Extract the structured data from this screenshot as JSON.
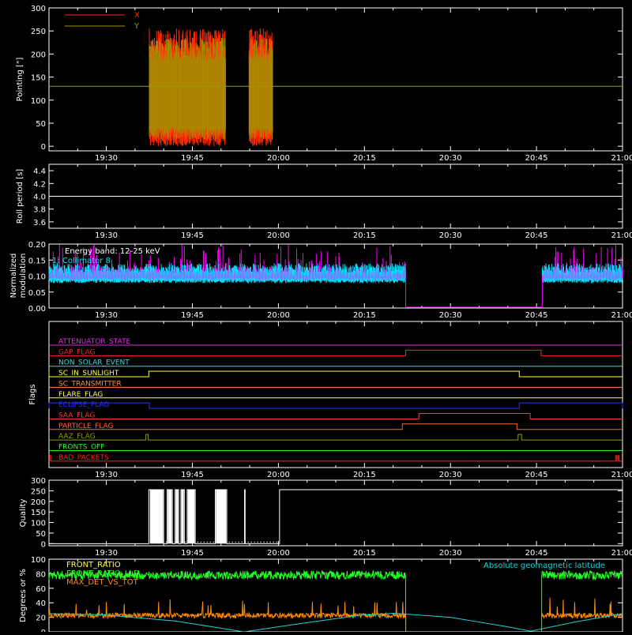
{
  "colors": {
    "background": "#000000",
    "axes": "#ffffff",
    "x_pointing": "#ff2a00",
    "y_pointing": "#9a9a00",
    "collimator": "#00e5ff",
    "modulation": "#ff00ff",
    "front_ratio": "#22ff22",
    "max_det": "#ff8c00",
    "geo_lat": "#22d0d0"
  },
  "time_axis": {
    "ticks": [
      "19:30",
      "19:45",
      "20:00",
      "20:15",
      "20:30",
      "20:45",
      "21:00"
    ],
    "tick_minutes": [
      1170,
      1185,
      1200,
      1215,
      1230,
      1245,
      1260
    ],
    "range_minutes": [
      1160,
      1260
    ]
  },
  "chart_data": [
    {
      "id": "pointing",
      "type": "line",
      "ylabel": "Pointing [\"]",
      "ylim": [
        -10,
        300
      ],
      "yticks": [
        0,
        50,
        100,
        150,
        200,
        250,
        300
      ],
      "legend": [
        "X",
        "Y"
      ],
      "segments": [
        [
          1177.5,
          1190.8
        ],
        [
          1194.9,
          1199.0
        ]
      ],
      "constant_line": 130,
      "series": [
        {
          "name": "X",
          "low": 0,
          "high": 255
        },
        {
          "name": "Y",
          "low": 15,
          "high": 235
        }
      ]
    },
    {
      "id": "roll",
      "type": "line",
      "ylabel": "Roll period [s]",
      "ylim": [
        3.5,
        4.5
      ],
      "yticks": [
        3.6,
        3.8,
        4.0,
        4.2,
        4.4
      ],
      "value": 4.0
    },
    {
      "id": "modulation",
      "type": "line",
      "ylabel": "Normalized modulation",
      "ylim": [
        0,
        0.2
      ],
      "yticks": [
        "0.00",
        "0.05",
        "0.10",
        "0.15",
        "0.20"
      ],
      "annotation_lines": [
        "Energy band: 12-25 keV",
        "1: Collimator 8"
      ],
      "active_segments": [
        [
          1160,
          1222.2
        ],
        [
          1246.0,
          1260
        ]
      ],
      "zero_segment": [
        1222.2,
        1246.0
      ],
      "baseline": 0.1
    },
    {
      "id": "flags",
      "type": "step",
      "ylabel": "Flags",
      "flags": [
        {
          "label": "ATTENUATOR_STATE",
          "color": "#e030e0",
          "steps": []
        },
        {
          "label": "GAP_FLAG",
          "color": "#ff2222",
          "steps": [
            [
              1222.2,
              1245.8
            ]
          ]
        },
        {
          "label": "NON_SOLAR_EVENT",
          "color": "#33dddd",
          "steps": []
        },
        {
          "label": "SC_IN_SUNLIGHT",
          "color": "#ffff44",
          "steps": [
            [
              1160,
              1160
            ],
            [
              1177.4,
              1242.0
            ]
          ]
        },
        {
          "label": "SC_TRANSMITTER",
          "color": "#ff8844",
          "steps": []
        },
        {
          "label": "FLARE_FLAG",
          "color": "#ffff44",
          "steps": []
        },
        {
          "label": "ECLIPSE_FLAG",
          "color": "#2233ff",
          "steps": [
            [
              1160,
              1177.5
            ],
            [
              1242.0,
              1260
            ]
          ]
        },
        {
          "label": "SAA_FLAG",
          "color": "#ff3333",
          "steps": [
            [
              1224.5,
              1243.9
            ]
          ]
        },
        {
          "label": "PARTICLE_FLAG",
          "color": "#ff6633",
          "steps": [
            [
              1221.6,
              1241.6
            ]
          ]
        },
        {
          "label": "AAZ_FLAG",
          "color": "#9a9a00",
          "steps": [
            [
              1176.9,
              1177.3
            ],
            [
              1241.8,
              1242.4
            ]
          ]
        },
        {
          "label": "FRONTS_OFF",
          "color": "#22ff22",
          "steps": []
        },
        {
          "label": "BAD_PACKETS",
          "color": "#ff2222",
          "steps": [
            [
              1160.1,
              1160.3
            ],
            [
              1258.8,
              1259.0
            ],
            [
              1259.2,
              1259.4
            ]
          ]
        }
      ]
    },
    {
      "id": "quality",
      "type": "step",
      "ylabel": "Quality",
      "ylim": [
        -10,
        300
      ],
      "yticks": [
        0,
        50,
        100,
        150,
        200,
        250,
        300
      ],
      "high_segments": [
        [
          1177.4,
          1194.2
        ],
        [
          1200.2,
          1260
        ]
      ],
      "max_value": 255
    },
    {
      "id": "front",
      "type": "line",
      "ylabel": "Degrees or %",
      "ylim": [
        0,
        100
      ],
      "yticks": [
        0,
        20,
        40,
        60,
        80,
        100
      ],
      "legend": [
        {
          "name": "FRONT_RATIO",
          "color": "#ffff44"
        },
        {
          "name": "FRONT_RATIO_LLD",
          "color": "#22ff22"
        },
        {
          "name": "MAX_DET_VS_TOT",
          "color": "#ff8c00"
        }
      ],
      "right_legend": {
        "name": "Absolute geomagnetic latitude",
        "color": "#22d0d0"
      },
      "active_segments": [
        [
          1160,
          1222.2
        ],
        [
          1245.9,
          1260
        ]
      ],
      "front_level": 78,
      "maxdet_level": 22,
      "geo_lat": [
        [
          1160,
          25
        ],
        [
          1169.3,
          23.5
        ],
        [
          1182.0,
          15
        ],
        [
          1194.0,
          0
        ],
        [
          1204.0,
          11.5
        ],
        [
          1214.0,
          22.5
        ],
        [
          1220.2,
          25.5
        ],
        [
          1230.0,
          20
        ],
        [
          1240.0,
          7
        ],
        [
          1244.0,
          1
        ],
        [
          1252.0,
          14
        ],
        [
          1260,
          25
        ]
      ]
    }
  ]
}
